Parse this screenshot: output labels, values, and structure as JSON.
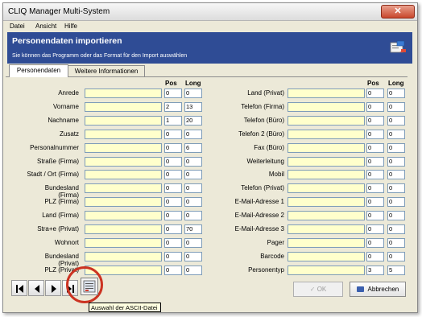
{
  "window": {
    "title": "CLIQ Manager Multi-System",
    "close_glyph": "✕"
  },
  "menu": [
    "Datei",
    "Ansicht",
    "Hilfe"
  ],
  "header": {
    "title": "Personendaten importieren",
    "subtitle": "Sie können das Programm oder das Format für den Import auswählen",
    "icon": "import-card-icon"
  },
  "tabs": [
    {
      "label": "Personendaten",
      "active": true
    },
    {
      "label": "Weitere Informationen",
      "active": false
    }
  ],
  "columns": {
    "pos": "Pos",
    "long": "Long"
  },
  "left_fields": [
    {
      "label": "Anrede",
      "value": "",
      "pos": "0",
      "long": "0"
    },
    {
      "label": "Vorname",
      "value": "",
      "pos": "2",
      "long": "13"
    },
    {
      "label": "Nachname",
      "value": "",
      "pos": "1",
      "long": "20"
    },
    {
      "label": "Zusatz",
      "value": "",
      "pos": "0",
      "long": "0"
    },
    {
      "label": "Personalnummer",
      "value": "",
      "pos": "0",
      "long": "6"
    },
    {
      "label": "Straße (Firma)",
      "value": "",
      "pos": "0",
      "long": "0"
    },
    {
      "label": "Stadt / Ort (Firma)",
      "value": "",
      "pos": "0",
      "long": "0"
    },
    {
      "label": "Bundesland (Firma)",
      "value": "",
      "pos": "0",
      "long": "0"
    },
    {
      "label": "PLZ (Firma)",
      "value": "",
      "pos": "0",
      "long": "0"
    },
    {
      "label": "Land (Firma)",
      "value": "",
      "pos": "0",
      "long": "0"
    },
    {
      "label": "Stra+e (Privat)",
      "value": "",
      "pos": "0",
      "long": "70"
    },
    {
      "label": "Wohnort",
      "value": "",
      "pos": "0",
      "long": "0"
    },
    {
      "label": "Bundesland (Privat)",
      "value": "",
      "pos": "0",
      "long": "0"
    },
    {
      "label": "PLZ (Privat)",
      "value": "",
      "pos": "0",
      "long": "0"
    }
  ],
  "right_fields": [
    {
      "label": "Land (Privat)",
      "value": "",
      "pos": "0",
      "long": "0"
    },
    {
      "label": "Telefon (Firma)",
      "value": "",
      "pos": "0",
      "long": "0"
    },
    {
      "label": "Telefon (Büro)",
      "value": "",
      "pos": "0",
      "long": "0"
    },
    {
      "label": "Telefon 2 (Büro)",
      "value": "",
      "pos": "0",
      "long": "0"
    },
    {
      "label": "Fax (Büro)",
      "value": "",
      "pos": "0",
      "long": "0"
    },
    {
      "label": "Weiterleitung",
      "value": "",
      "pos": "0",
      "long": "0"
    },
    {
      "label": "Mobil",
      "value": "",
      "pos": "0",
      "long": "0"
    },
    {
      "label": "Telefon (Privat)",
      "value": "",
      "pos": "0",
      "long": "0"
    },
    {
      "label": "E-Mail-Adresse 1",
      "value": "",
      "pos": "0",
      "long": "0"
    },
    {
      "label": "E-Mail-Adresse 2",
      "value": "",
      "pos": "0",
      "long": "0"
    },
    {
      "label": "E-Mail-Adresse 3",
      "value": "",
      "pos": "0",
      "long": "0"
    },
    {
      "label": "Pager",
      "value": "",
      "pos": "0",
      "long": "0"
    },
    {
      "label": "Barcode",
      "value": "",
      "pos": "0",
      "long": "0"
    },
    {
      "label": "Personentyp",
      "value": "",
      "pos": "3",
      "long": "5"
    }
  ],
  "nav": [
    "first-record-icon",
    "prev-record-icon",
    "next-record-icon",
    "last-record-icon"
  ],
  "ascii_button": {
    "icon": "ascii-file-icon",
    "tooltip": "Auswahl der ASCII-Datei"
  },
  "buttons": {
    "ok": "OK",
    "cancel": "Abbrechen"
  },
  "colors": {
    "header_bg": "#2f4c95",
    "field_bg": "#ffffcc",
    "highlight_ring": "#cc3322"
  }
}
